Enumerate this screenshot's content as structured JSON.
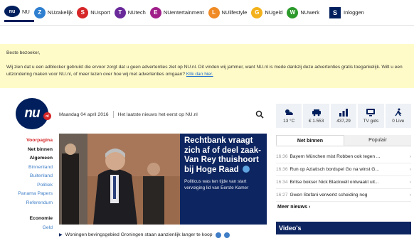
{
  "network": {
    "items": [
      {
        "label": "NU",
        "color": "#001f5c",
        "letter": "nu"
      },
      {
        "label": "NUzakelijk",
        "color": "#2f7fd0",
        "letter": "Z"
      },
      {
        "label": "NUsport",
        "color": "#d62628",
        "letter": "S"
      },
      {
        "label": "NUtech",
        "color": "#6a2a9a",
        "letter": "T"
      },
      {
        "label": "NUentertainment",
        "color": "#a0208a",
        "letter": "E"
      },
      {
        "label": "NUlifestyle",
        "color": "#f08a24",
        "letter": "L"
      },
      {
        "label": "NUgeld",
        "color": "#f3b21b",
        "letter": "G"
      },
      {
        "label": "NUwerk",
        "color": "#2b9a2b",
        "letter": "W"
      }
    ],
    "login_letter": "S",
    "login_label": "Inloggen"
  },
  "notice": {
    "greeting": "Beste bezoeker,",
    "text": "Wij zien dat u een adblocker gebruikt die ervoor zorgt dat u geen advertenties ziet op NU.nl. Dit vinden wij jammer, want NU.nl is mede dankzij deze advertenties gratis toegankelijk. Wilt u een uitzondering maken voor NU.nl, of meer lezen over hoe wij met advertenties omgaan?",
    "link": "Klik dan hier."
  },
  "logo": {
    "text": "nu",
    "dot": "nl"
  },
  "datebar": {
    "date": "Maandag 04 april 2016",
    "tagline": "Het laatste nieuws het eerst op NU.nl"
  },
  "sidenav": {
    "items": [
      {
        "label": "Voorpagina",
        "style": "red"
      },
      {
        "label": "Net binnen",
        "style": "bold"
      },
      {
        "label": "Algemeen",
        "style": "bold"
      },
      {
        "label": "Binnenland",
        "style": "blue"
      },
      {
        "label": "Buitenland",
        "style": "blue"
      },
      {
        "label": "Politiek",
        "style": "blue"
      },
      {
        "label": "Panama Papers",
        "style": "blue"
      },
      {
        "label": "Referendum",
        "style": "blue"
      }
    ],
    "section2": [
      {
        "label": "Economie",
        "style": "bold"
      },
      {
        "label": "Geld",
        "style": "blue"
      }
    ]
  },
  "hero": {
    "title": "Rechtbank vraagt zich af of deel zaak-Van Rey thuishoort bij Hoge Raad",
    "subtitle": "Politicus was ten tijde van start vervolging lid van Eerste Kamer"
  },
  "bottom_articles": [
    "Woningen bevingsgebied Groningen staan aanzienlijk langer te koop"
  ],
  "widgets": [
    {
      "icon": "weather-icon",
      "label": "13 °C"
    },
    {
      "icon": "traffic-icon",
      "label": "€ 1.553"
    },
    {
      "icon": "stocks-icon",
      "label": "437,29"
    },
    {
      "icon": "tv-icon",
      "label": "TV gids"
    },
    {
      "icon": "live-icon",
      "label": "0 Live"
    }
  ],
  "tabs": [
    {
      "label": "Net binnen",
      "active": true
    },
    {
      "label": "Populair",
      "active": false
    }
  ],
  "news": [
    {
      "time": "16:36",
      "title": "Bayern München mist Robben ook tegen ..."
    },
    {
      "time": "16:36",
      "title": "Run op Aziatisch bordspel Go na winst G..."
    },
    {
      "time": "16:34",
      "title": "Britse bokser Nick Blackwell ontwaakt uit..."
    },
    {
      "time": "16:27",
      "title": "Gwen Stefani verwerkt scheiding nog"
    }
  ],
  "more_news": "Meer nieuws",
  "videos_title": "Video's"
}
